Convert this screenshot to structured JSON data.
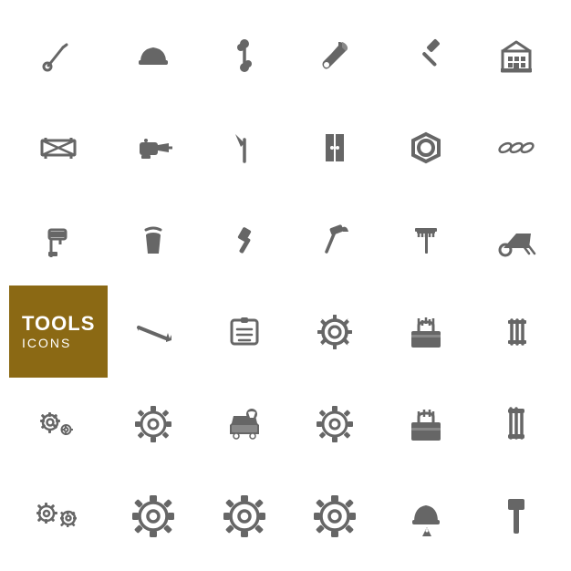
{
  "title": "Tools Icons",
  "label": {
    "title": "TOOLS",
    "subtitle": "ICONS",
    "bg_color": "#8B6914"
  },
  "icons": [
    {
      "name": "wrench",
      "row": 1,
      "col": 1
    },
    {
      "name": "hardhat",
      "row": 1,
      "col": 2
    },
    {
      "name": "bone-wrench",
      "row": 1,
      "col": 3
    },
    {
      "name": "wrench2",
      "row": 1,
      "col": 4
    },
    {
      "name": "hammer",
      "row": 1,
      "col": 5
    },
    {
      "name": "building",
      "row": 1,
      "col": 6
    },
    {
      "name": "barrier",
      "row": 2,
      "col": 1
    },
    {
      "name": "drill",
      "row": 2,
      "col": 2
    },
    {
      "name": "pickaxe",
      "row": 2,
      "col": 3
    },
    {
      "name": "door",
      "row": 2,
      "col": 4
    },
    {
      "name": "nut",
      "row": 2,
      "col": 5
    },
    {
      "name": "chain",
      "row": 2,
      "col": 6
    },
    {
      "name": "paint-roller",
      "row": 3,
      "col": 1
    },
    {
      "name": "bucket",
      "row": 3,
      "col": 2
    },
    {
      "name": "hammer2",
      "row": 3,
      "col": 3
    },
    {
      "name": "claw-hammer",
      "row": 3,
      "col": 4
    },
    {
      "name": "rake",
      "row": 3,
      "col": 5
    },
    {
      "name": "wheelbarrow",
      "row": 3,
      "col": 6
    },
    {
      "name": "label-placeholder",
      "row": 4,
      "col": 1
    },
    {
      "name": "saw",
      "row": 4,
      "col": 2
    },
    {
      "name": "tag",
      "row": 4,
      "col": 3
    },
    {
      "name": "gear-detail",
      "row": 4,
      "col": 4
    },
    {
      "name": "toolbox",
      "row": 4,
      "col": 5
    },
    {
      "name": "tools-vertical",
      "row": 4,
      "col": 6
    },
    {
      "name": "gears-small",
      "row": 5,
      "col": 1
    },
    {
      "name": "gear-medium",
      "row": 5,
      "col": 2
    },
    {
      "name": "car-wrench",
      "row": 5,
      "col": 3
    },
    {
      "name": "gear3",
      "row": 5,
      "col": 4
    },
    {
      "name": "toolbox2",
      "row": 5,
      "col": 5
    },
    {
      "name": "pliers",
      "row": 5,
      "col": 6
    },
    {
      "name": "gears-bottom",
      "row": 6,
      "col": 1
    },
    {
      "name": "gear-lg",
      "row": 6,
      "col": 2
    },
    {
      "name": "gear-lg2",
      "row": 6,
      "col": 3
    },
    {
      "name": "gear-lg3",
      "row": 6,
      "col": 4
    },
    {
      "name": "helmet-warning",
      "row": 6,
      "col": 5
    },
    {
      "name": "hammer-bottom",
      "row": 6,
      "col": 6
    }
  ]
}
